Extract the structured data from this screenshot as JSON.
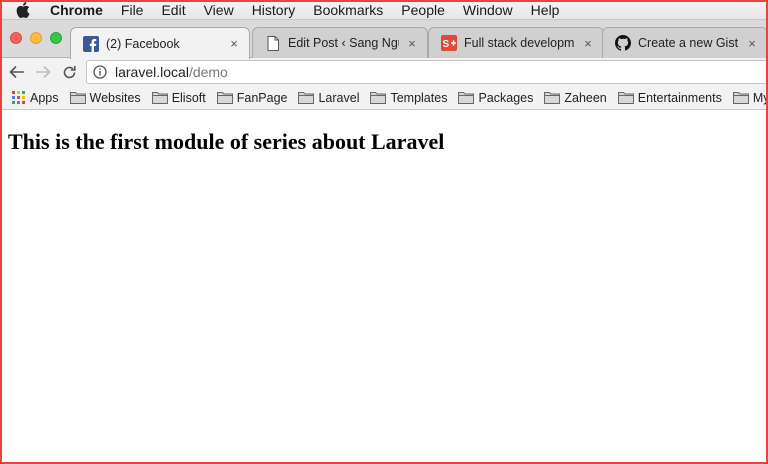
{
  "menubar": {
    "app_name": "Chrome",
    "items": [
      "File",
      "Edit",
      "View",
      "History",
      "Bookmarks",
      "People",
      "Window",
      "Help"
    ]
  },
  "tabs": [
    {
      "title": "(2) Facebook",
      "icon": "facebook-icon",
      "active": true
    },
    {
      "title": "Edit Post ‹ Sang Nguyen",
      "icon": "document-icon",
      "active": false
    },
    {
      "title": "Full stack development",
      "icon": "google-plus-icon",
      "active": false
    },
    {
      "title": "Create a new Gist",
      "icon": "github-icon",
      "active": false
    }
  ],
  "tab_close_glyph": "×",
  "address_bar": {
    "host": "laravel.local",
    "path": "/demo"
  },
  "bookmarks": [
    {
      "label": "Apps",
      "icon": "apps-grid-icon"
    },
    {
      "label": "Websites",
      "icon": "folder-icon"
    },
    {
      "label": "Elisoft",
      "icon": "folder-icon"
    },
    {
      "label": "FanPage",
      "icon": "folder-icon"
    },
    {
      "label": "Laravel",
      "icon": "folder-icon"
    },
    {
      "label": "Templates",
      "icon": "folder-icon"
    },
    {
      "label": "Packages",
      "icon": "folder-icon"
    },
    {
      "label": "Zaheen",
      "icon": "folder-icon"
    },
    {
      "label": "Entertainments",
      "icon": "folder-icon"
    },
    {
      "label": "Mypage",
      "icon": "folder-icon"
    }
  ],
  "page": {
    "heading": "This is the first module of series about Laravel"
  },
  "colors": {
    "frame_border": "#e8433c",
    "facebook_blue": "#3b5998",
    "google_plus_red": "#dd4b39"
  }
}
